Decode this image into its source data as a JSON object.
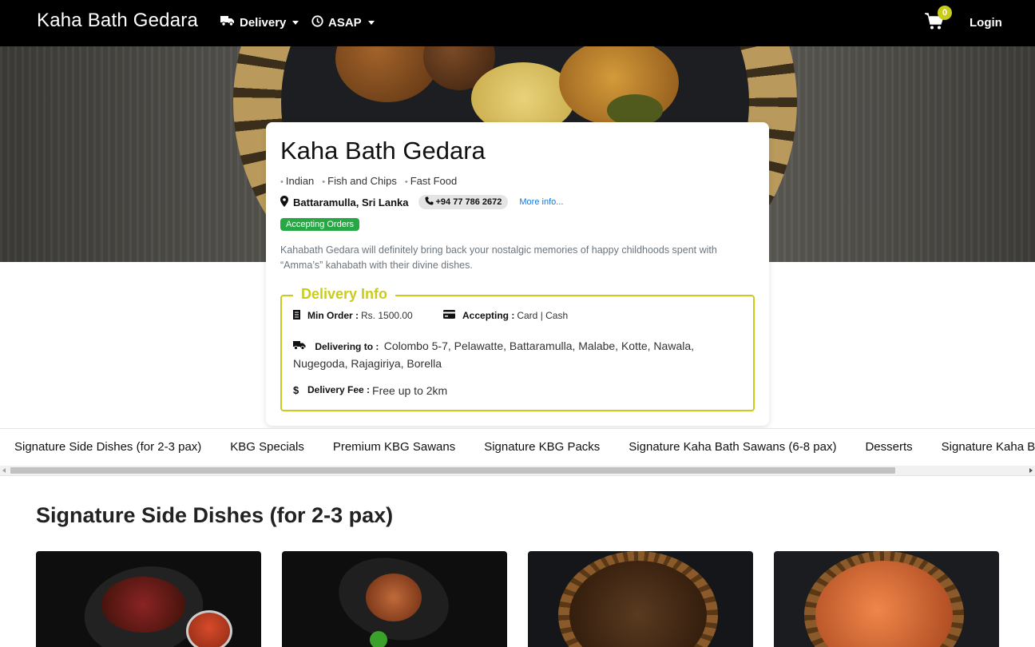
{
  "navbar": {
    "brand": "Kaha Bath Gedara",
    "delivery_label": "Delivery",
    "asap_label": "ASAP",
    "cart_count": "0",
    "login_label": "Login"
  },
  "restaurant": {
    "name": "Kaha Bath Gedara",
    "cuisines": [
      "Indian",
      "Fish and Chips",
      "Fast Food"
    ],
    "location": "Battaramulla, Sri Lanka",
    "phone": "+94 77 786 2672",
    "more_info": "More info...",
    "status": "Accepting Orders",
    "description": "Kahabath Gedara will definitely bring back your nostalgic memories of happy childhoods spent with “Amma’s” kahabath with their divine dishes."
  },
  "delivery_info": {
    "title": "Delivery Info",
    "min_order_label": "Min Order :",
    "min_order_value": "Rs. 1500.00",
    "accepting_label": "Accepting :",
    "accepting_value": "Card | Cash",
    "delivering_to_label": "Delivering to :",
    "delivering_to_value": "Colombo 5-7, Pelawatte, Battaramulla, Malabe, Kotte, Nawala, Nugegoda, Rajagiriya, Borella",
    "fee_label": "Delivery Fee :",
    "fee_value": "Free up to 2km"
  },
  "categories": [
    "Signature Side Dishes (for 2-3 pax)",
    "KBG Specials",
    "Premium KBG Sawans",
    "Signature KBG Packs",
    "Signature Kaha Bath Sawans (6-8 pax)",
    "Desserts",
    "Signature Kaha Bath Sawans"
  ],
  "section": {
    "title": "Signature Side Dishes (for 2-3 pax)"
  },
  "colors": {
    "accent": "#c9cc1a",
    "status_green": "#28a745",
    "link_blue": "#1877d6",
    "navbar_bg": "#000000"
  }
}
